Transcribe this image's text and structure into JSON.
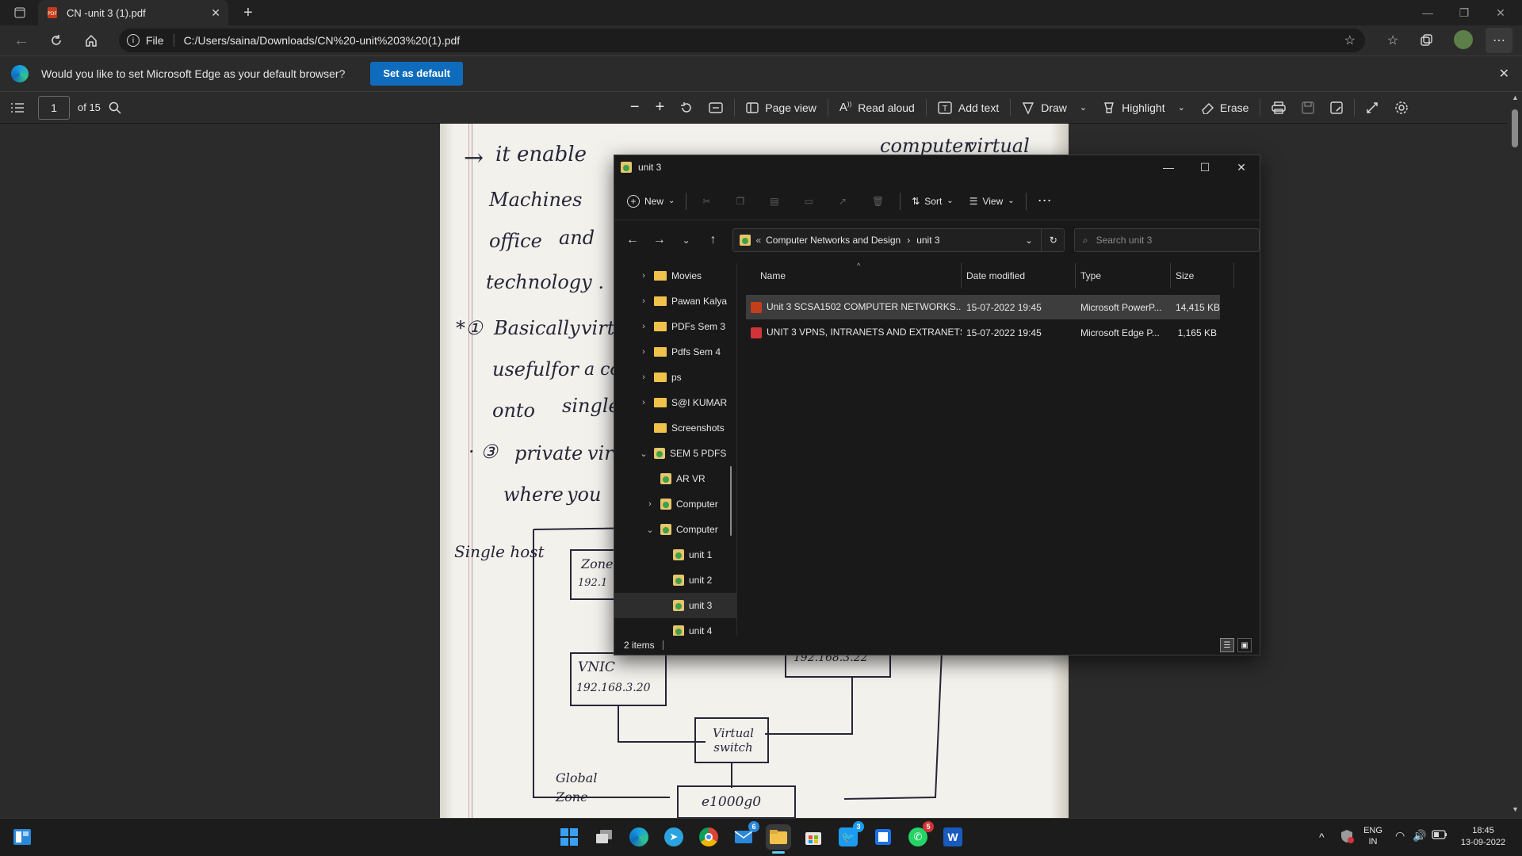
{
  "browser": {
    "tab_title": "CN -unit 3 (1).pdf",
    "site_info": "File",
    "url": "C:/Users/saina/Downloads/CN%20-unit%203%20(1).pdf"
  },
  "infobar": {
    "message": "Would you like to set Microsoft Edge as your default browser?",
    "button": "Set as default"
  },
  "pdf_toolbar": {
    "page_number": "1",
    "page_total": "of 15",
    "page_view": "Page view",
    "read_aloud": "Read aloud",
    "add_text": "Add text",
    "draw": "Draw",
    "highlight": "Highlight",
    "erase": "Erase"
  },
  "pdf_page": {
    "lines": [
      "it enable",
      "computer",
      "virtual",
      "Machines",
      "office",
      "and",
      "technology .",
      "Basically",
      "virtu",
      "useful",
      "for",
      "a co",
      "onto",
      "single",
      "private",
      "vir",
      "where",
      "you"
    ],
    "diagram": {
      "single_host": "Single host",
      "zone": "Zone",
      "zone_ip": "192.1",
      "vnic": "VNIC",
      "vnic_ip": "192.168.3.20",
      "right_ip": "192.168.3.22",
      "virtual_switch": "Virtual switch",
      "global_zone": "Global Zone",
      "e1000g0": "e1000g0"
    }
  },
  "explorer": {
    "title": "unit 3",
    "commands": {
      "new": "New",
      "sort": "Sort",
      "view": "View"
    },
    "breadcrumb": [
      "Computer Networks and Design",
      "unit 3"
    ],
    "search_placeholder": "Search unit 3",
    "nav_items": [
      {
        "label": "Movies",
        "chevron": "›"
      },
      {
        "label": "Pawan Kalya",
        "chevron": "›"
      },
      {
        "label": "PDFs Sem 3",
        "chevron": "›"
      },
      {
        "label": "Pdfs Sem 4",
        "chevron": "›"
      },
      {
        "label": "ps",
        "chevron": "›"
      },
      {
        "label": "S@I KUMAR",
        "chevron": "›"
      },
      {
        "label": "Screenshots",
        "chevron": ""
      },
      {
        "label": "SEM 5 PDFS",
        "chevron": "⌄"
      },
      {
        "label": "AR VR",
        "chevron": ""
      },
      {
        "label": "Computer",
        "chevron": "›"
      },
      {
        "label": "Computer",
        "chevron": "⌄"
      },
      {
        "label": "unit 1",
        "chevron": ""
      },
      {
        "label": "unit 2",
        "chevron": ""
      },
      {
        "label": "unit 3",
        "chevron": ""
      },
      {
        "label": "unit 4",
        "chevron": ""
      }
    ],
    "columns": [
      "Name",
      "Date modified",
      "Type",
      "Size"
    ],
    "files": [
      {
        "name": "Unit 3 SCSA1502 COMPUTER NETWORKS...",
        "date": "15-07-2022 19:45",
        "type": "Microsoft PowerP...",
        "size": "14,415 KB"
      },
      {
        "name": "UNIT 3 VPNS, INTRANETS AND EXTRANETS",
        "date": "15-07-2022 19:45",
        "type": "Microsoft Edge P...",
        "size": "1,165 KB"
      }
    ],
    "status": "2 items"
  },
  "taskbar": {
    "mail_badge": "6",
    "twitter_badge": "3",
    "whatsapp_badge": "5",
    "lang": "ENG",
    "region": "IN",
    "time": "18:45",
    "date": "13-09-2022"
  },
  "colors": {
    "accent": "#0f6cbd",
    "folder": "#f0c24b"
  }
}
